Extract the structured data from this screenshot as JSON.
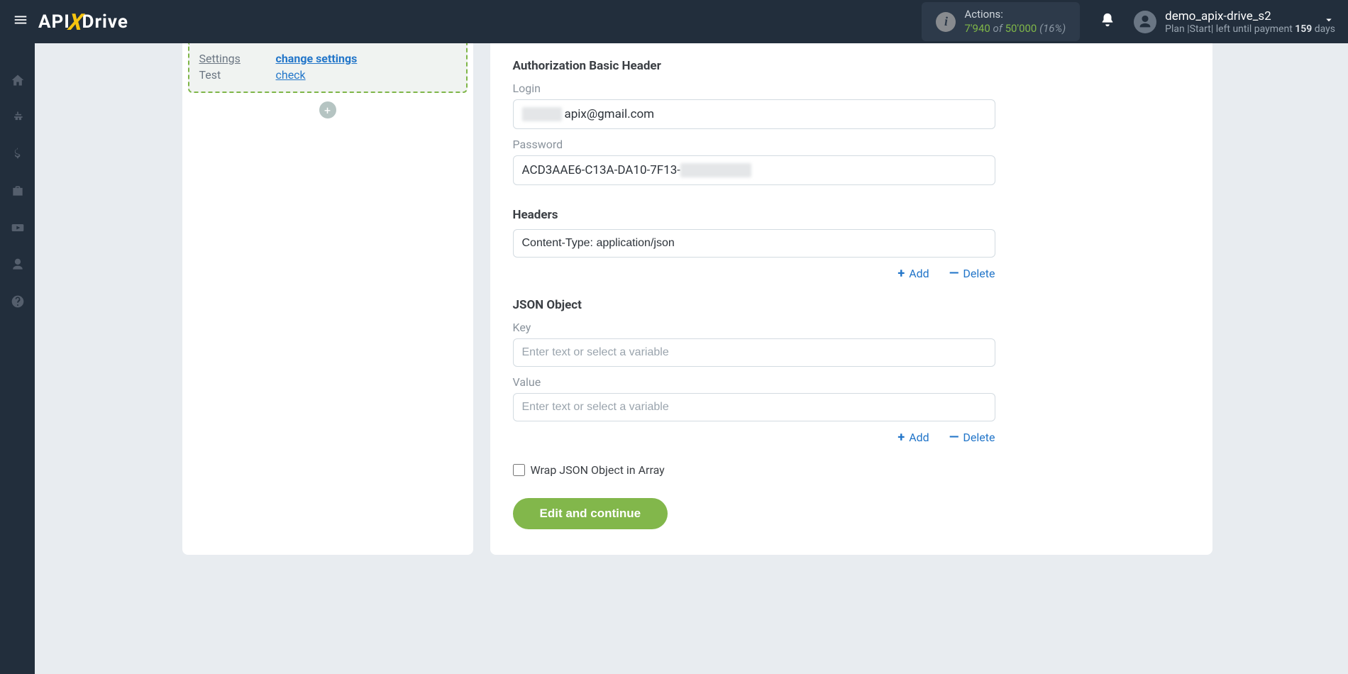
{
  "header": {
    "logo": {
      "part1": "API",
      "part2": "X",
      "part3": "Drive"
    },
    "actions": {
      "label": "Actions:",
      "used": "7'940",
      "of": "of",
      "total": "50'000",
      "percent": "(16%)"
    },
    "user": {
      "name": "demo_apix-drive_s2",
      "plan_prefix": "Plan |Start| left until payment ",
      "plan_days_num": "159",
      "plan_days_word": " days"
    }
  },
  "left_panel": {
    "rows": [
      {
        "label": "Settings",
        "link": "change settings",
        "label_underline": true,
        "link_bold": true
      },
      {
        "label": "Test",
        "link": "check",
        "label_underline": false,
        "link_bold": false
      }
    ]
  },
  "form": {
    "auth_title": "Authorization Basic Header",
    "login_label": "Login",
    "login_value": "apix@gmail.com",
    "password_label": "Password",
    "password_value": "ACD3AAE6-C13A-DA10-7F13-",
    "headers_title": "Headers",
    "headers_value": "Content-Type: application/json",
    "headers_add": "Add",
    "headers_delete": "Delete",
    "json_title": "JSON Object",
    "key_label": "Key",
    "key_placeholder": "Enter text or select a variable",
    "value_label": "Value",
    "value_placeholder": "Enter text or select a variable",
    "json_add": "Add",
    "json_delete": "Delete",
    "wrap_label": "Wrap JSON Object in Array",
    "cta": "Edit and continue"
  },
  "icons": {
    "plus": "+",
    "minus": "—"
  }
}
